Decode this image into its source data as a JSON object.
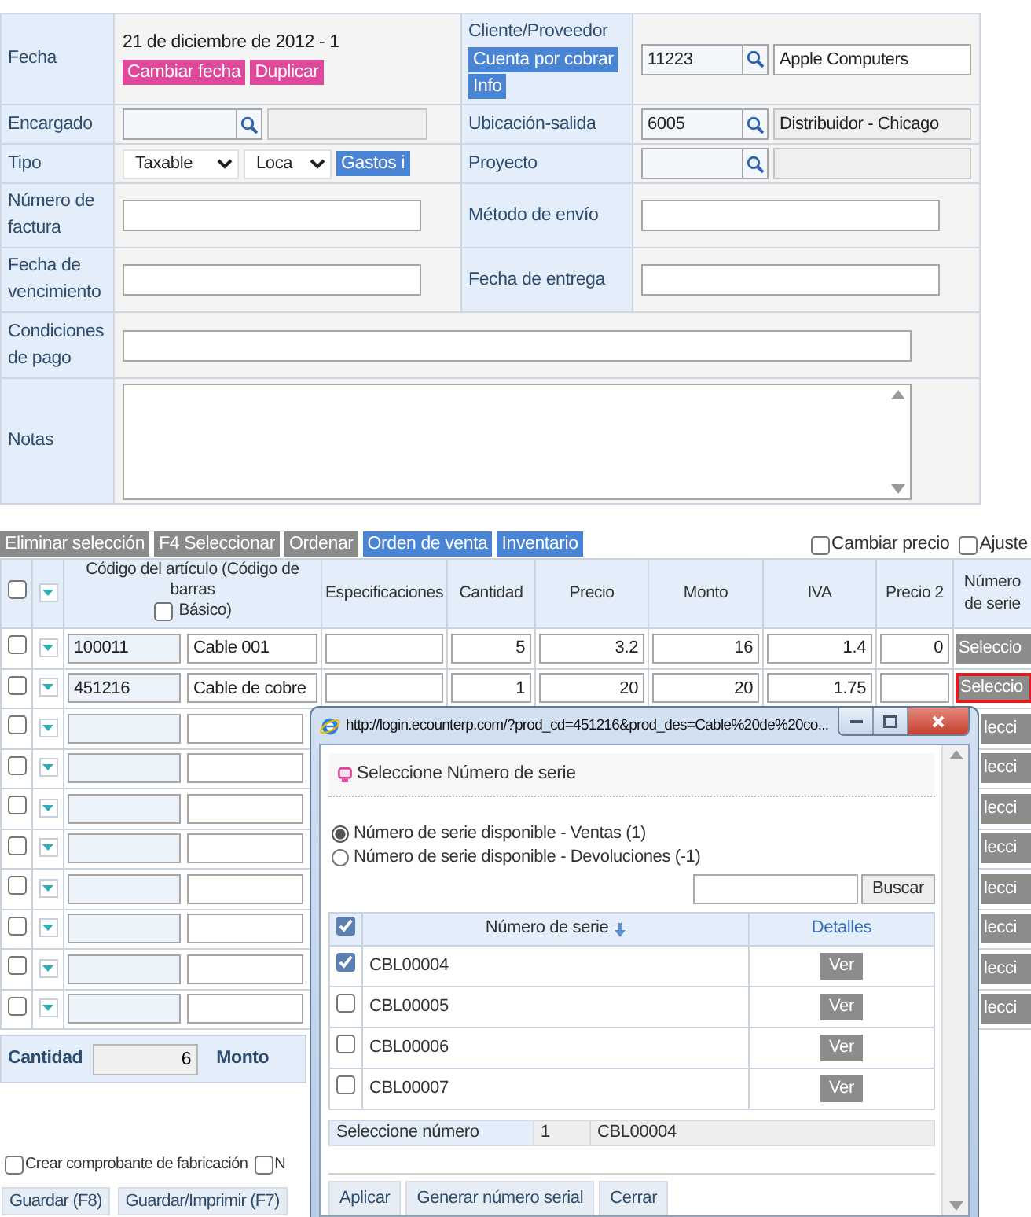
{
  "form": {
    "rows": [
      [
        {
          "label": "Fecha",
          "items": [
            {
              "kind": "text",
              "text": "21 de diciembre de 2012 - 1"
            },
            {
              "kind": "button",
              "label": "Cambiar fecha",
              "color": "#e0489c"
            },
            {
              "kind": "button",
              "label": "Duplicar",
              "color": "#e0489c"
            }
          ]
        },
        {
          "label": "Cliente/Proveedor",
          "label_buttons": [
            {
              "label": "Cuenta por cobrar",
              "color": "#4a84d4"
            },
            {
              "label": "Info",
              "color": "#4a84d4"
            }
          ],
          "items": [
            {
              "kind": "lookup",
              "value": "11223"
            },
            {
              "kind": "input",
              "value": "Apple Computers",
              "disabled": false
            }
          ]
        }
      ],
      [
        {
          "label": "Encargado",
          "items": [
            {
              "kind": "lookup"
            },
            {
              "kind": "input",
              "disabled": true
            }
          ]
        },
        {
          "label": "Ubicación-salida",
          "items": [
            {
              "kind": "lookup",
              "value": "6005"
            },
            {
              "kind": "input",
              "value": "Distribuidor - Chicago",
              "disabled": true
            }
          ]
        }
      ],
      [
        {
          "label": "Tipo",
          "items": [
            {
              "kind": "select",
              "value": "Taxable"
            },
            {
              "kind": "select",
              "value": "Loca"
            },
            {
              "kind": "button",
              "label": "Gastos i",
              "color": "#4a84d4"
            }
          ]
        },
        {
          "label": "Proyecto",
          "items": [
            {
              "kind": "lookup"
            },
            {
              "kind": "input",
              "disabled": true
            }
          ]
        }
      ],
      [
        {
          "label": "Número de factura",
          "items": [
            {
              "kind": "input",
              "disabled": false
            }
          ]
        },
        {
          "label": "Método de envío",
          "items": [
            {
              "kind": "input",
              "disabled": false
            }
          ]
        }
      ],
      [
        {
          "label": "Fecha de vencimiento",
          "items": [
            {
              "kind": "input",
              "disabled": false
            }
          ]
        },
        {
          "label": "Fecha de entrega",
          "items": [
            {
              "kind": "input",
              "disabled": false
            }
          ]
        }
      ],
      [
        {
          "label": "Condiciones de pago",
          "items": [
            {
              "kind": "input",
              "disabled": false
            }
          ]
        }
      ],
      [
        {
          "label": "Notas",
          "items": [
            {
              "kind": "textarea"
            }
          ]
        }
      ]
    ]
  },
  "toolbar": {
    "buttons": [
      {
        "label": "Eliminar selección",
        "color": "#8a8a8a"
      },
      {
        "label": "F4 Seleccionar",
        "color": "#8a8a8a"
      },
      {
        "label": "Ordenar",
        "color": "#8a8a8a"
      },
      {
        "label": "Orden de venta",
        "color": "#4a84d4"
      },
      {
        "label": "Inventario",
        "color": "#4a84d4"
      }
    ],
    "options": [
      {
        "label": "Cambiar precio",
        "checked": false
      },
      {
        "label": "Ajuste",
        "checked": false
      }
    ]
  },
  "items": {
    "all_checked": false,
    "columns": [
      {
        "kind": "code",
        "label": "Código del artículo (Código de barras",
        "option": {
          "label": "Básico)",
          "checked": false
        }
      },
      {
        "kind": "text",
        "label": "Especificaciones"
      },
      {
        "kind": "text",
        "label": "Cantidad"
      },
      {
        "kind": "text",
        "label": "Precio"
      },
      {
        "kind": "text",
        "label": "Monto"
      },
      {
        "kind": "text",
        "label": "IVA"
      },
      {
        "kind": "text",
        "label": "Precio 2"
      },
      {
        "kind": "text",
        "label": "Número de serie"
      }
    ],
    "rows": [
      {
        "checked": false,
        "covered": false,
        "code": "100011",
        "name": "Cable 001",
        "quantity": "5",
        "price": "3.2",
        "amount": "16",
        "vat": "1.4",
        "price2": "0",
        "serial": {
          "label": "Seleccio",
          "highlighted": false
        }
      },
      {
        "checked": false,
        "covered": false,
        "code": "451216",
        "name": "Cable de cobre",
        "quantity": "1",
        "price": "20",
        "amount": "20",
        "vat": "1.75",
        "serial": {
          "label": "Seleccio",
          "highlighted": true
        }
      },
      {
        "checked": false,
        "covered": true,
        "serial": {
          "label": "lecci",
          "highlighted": false
        }
      },
      {
        "checked": false,
        "covered": true,
        "serial": {
          "label": "lecci",
          "highlighted": false
        }
      },
      {
        "checked": false,
        "covered": true,
        "serial": {
          "label": "lecci",
          "highlighted": false
        }
      },
      {
        "checked": false,
        "covered": true,
        "serial": {
          "label": "lecci",
          "highlighted": false
        }
      },
      {
        "checked": false,
        "covered": true,
        "serial": {
          "label": "lecci",
          "highlighted": false
        }
      },
      {
        "checked": false,
        "covered": true,
        "serial": {
          "label": "lecci",
          "highlighted": false
        }
      },
      {
        "checked": false,
        "covered": true,
        "serial": {
          "label": "lecci",
          "highlighted": false
        }
      },
      {
        "checked": false,
        "covered": true,
        "serial": {
          "label": "lecci",
          "highlighted": false
        }
      }
    ]
  },
  "totals": {
    "quantity_label": "Cantidad",
    "quantity": "6",
    "amount_label": "Monto"
  },
  "footer": {
    "options": [
      {
        "label": "Crear comprobante de fabricación",
        "checked": false
      },
      {
        "label": "N",
        "checked": false
      }
    ],
    "buttons": [
      "Guardar (F8)",
      "Guardar/Imprimir (F7)"
    ]
  },
  "popup": {
    "title": "http://login.ecounterp.com/?prod_cd=451216&prod_des=Cable%20de%20co...",
    "heading": "Seleccione Número de serie",
    "filters": [
      {
        "label": "Número de serie disponible - Ventas (1)",
        "selected": true
      },
      {
        "label": "Número de serie disponible - Devoluciones (-1)",
        "selected": false
      }
    ],
    "search_button": "Buscar",
    "all_checked": true,
    "columns": [
      {
        "label": "Número de serie",
        "sorted": true
      },
      {
        "label": "Detalles",
        "sorted": false
      }
    ],
    "rows": [
      {
        "serial": "CBL00004",
        "checked": true,
        "action": "Ver"
      },
      {
        "serial": "CBL00005",
        "checked": false,
        "action": "Ver"
      },
      {
        "serial": "CBL00006",
        "checked": false,
        "action": "Ver"
      },
      {
        "serial": "CBL00007",
        "checked": false,
        "action": "Ver"
      }
    ],
    "summary": {
      "label": "Seleccione número",
      "count": "1",
      "value": "CBL00004"
    },
    "buttons": [
      "Aplicar",
      "Generar número serial",
      "Cerrar"
    ]
  }
}
